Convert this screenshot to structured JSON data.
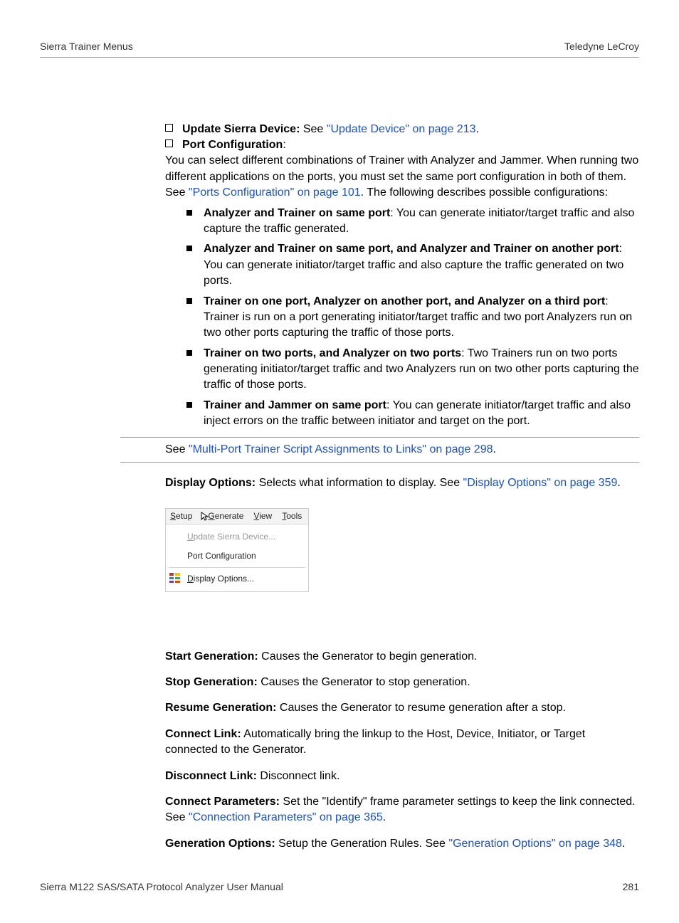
{
  "header": {
    "left": "Sierra Trainer Menus",
    "right": "Teledyne LeCroy"
  },
  "item1": {
    "label": "Update Sierra Device:",
    "afterLabel": " See ",
    "link": "\"Update Device\" on page 213",
    "tail": "."
  },
  "item2": {
    "label": "Port Configuration",
    "colon": ":",
    "text1": "You can select different combinations of Trainer with Analyzer and Jammer. When running two different applications on the ports, you must set the same port configuration in both of them. See ",
    "link": "\"Ports Configuration\" on page 101",
    "text2": ". The following describes possible configurations:"
  },
  "sub": [
    {
      "bold": "Analyzer and Trainer on same port",
      "rest": ": You can generate initiator/target traffic and also capture the traffic generated."
    },
    {
      "bold": "Analyzer and Trainer on same port, and Analyzer and Trainer on another port",
      "rest": ": You can generate initiator/target traffic and also capture the traffic generated on two ports."
    },
    {
      "bold": "Trainer on one port, Analyzer on another port, and Analyzer on a third port",
      "rest": ": Trainer is run on a port generating initiator/target traffic and two port Analyzers run on two other ports capturing the traffic of those ports."
    },
    {
      "bold": "Trainer on two ports, and Analyzer on two ports",
      "rest": ": Two Trainers run on two ports generating initiator/target traffic and two Analyzers run on two other ports capturing the traffic of those ports."
    },
    {
      "bold": "Trainer and Jammer on same port",
      "rest": ": You can generate initiator/target traffic and also inject errors on the traffic between initiator and target on the port."
    }
  ],
  "seeAlso": {
    "pre": "See ",
    "link": "\"Multi-Port Trainer Script Assignments to Links\" on page 298",
    "post": "."
  },
  "displayOptions": {
    "label": "Display Options:",
    "text": " Selects what information to display. See ",
    "link": "\"Display Options\" on page 359",
    "post": "."
  },
  "menu": {
    "bar": {
      "setup_pre": "S",
      "setup_rest": "etup",
      "generate_pre": "G",
      "generate_rest": "enerate",
      "view_pre": "V",
      "view_rest": "iew",
      "tools_pre": "T",
      "tools_rest": "ools"
    },
    "update_pre": "U",
    "update_rest": "pdate Sierra Device...",
    "portconfig": "Port Configuration",
    "display_pre": "D",
    "display_rest": "isplay Options..."
  },
  "defs": {
    "startGen": {
      "label": "Start Generation:",
      "text": " Causes the Generator to begin generation."
    },
    "stopGen": {
      "label": "Stop Generation:",
      "text": " Causes the Generator to stop generation."
    },
    "resumeGen": {
      "label": "Resume Generation:",
      "text": " Causes the Generator to resume generation after a stop."
    },
    "connectLink": {
      "label": "Connect Link:",
      "text": " Automatically bring the linkup to the Host, Device, Initiator, or Target connected to the Generator."
    },
    "disconnectLink": {
      "label": "Disconnect Link:",
      "text": " Disconnect link."
    },
    "connectParams": {
      "label": "Connect Parameters:",
      "text": " Set the \"Identify\" frame parameter settings to keep the link connected. See ",
      "link": "\"Connection Parameters\" on page 365",
      "post": "."
    },
    "genOptions": {
      "label": "Generation Options:",
      "text": " Setup the Generation Rules. See ",
      "link": "\"Generation Options\" on page 348",
      "post": "."
    }
  },
  "footer": {
    "left": "Sierra M122 SAS/SATA Protocol Analyzer User Manual",
    "right": "281"
  }
}
